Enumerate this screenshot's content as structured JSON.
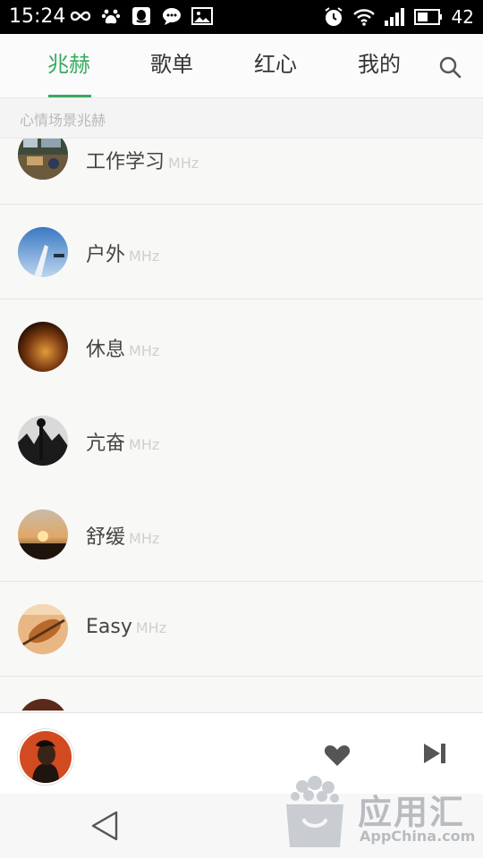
{
  "status_bar": {
    "time": "15:24",
    "battery": "42",
    "left_icons": [
      "infinity-icon",
      "paw-icon",
      "qq-icon",
      "chat-bubble-icon",
      "image-icon"
    ],
    "right_icons": [
      "alarm-icon",
      "wifi-icon",
      "signal-icon",
      "battery-icon"
    ]
  },
  "tabs": [
    {
      "label": "兆赫",
      "active": true
    },
    {
      "label": "歌单",
      "active": false
    },
    {
      "label": "红心",
      "active": false
    },
    {
      "label": "我的",
      "active": false
    }
  ],
  "accent_color": "#39a960",
  "section_header": "心情场景兆赫",
  "channels": [
    {
      "name": "工作学习",
      "suffix": "MHz",
      "cover": "office-desk"
    },
    {
      "name": "户外",
      "suffix": "MHz",
      "cover": "sky-outdoors"
    },
    {
      "name": "休息",
      "suffix": "MHz",
      "cover": "warm-light"
    },
    {
      "name": "亢奋",
      "suffix": "MHz",
      "cover": "monochrome-crowd"
    },
    {
      "name": "舒缓",
      "suffix": "MHz",
      "cover": "sunset"
    },
    {
      "name": "Easy",
      "suffix": "MHz",
      "cover": "guitar"
    }
  ],
  "player": {
    "cover": "artist-portrait",
    "icons": [
      "heart-icon",
      "skip-next-icon"
    ]
  },
  "nav": {
    "back_icon": "back-triangle-icon"
  },
  "watermark": {
    "title": "应用汇",
    "subtitle": "AppChina.com"
  }
}
